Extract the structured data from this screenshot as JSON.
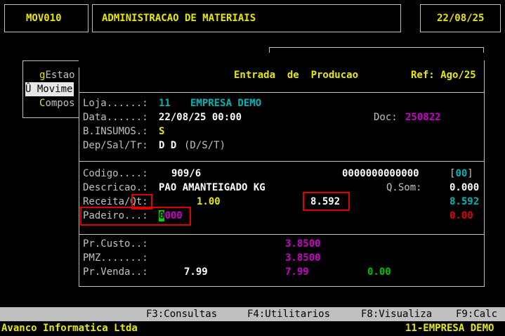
{
  "header": {
    "program": "MOV010",
    "title": "ADMINISTRACAO DE MATERIAIS",
    "date": "22/08/25"
  },
  "menu": {
    "items": [
      {
        "hot": "g",
        "rest": "Estao"
      },
      {
        "hot": "Û",
        "rest": " Movime"
      },
      {
        "hot": "C",
        "rest": "ompos"
      }
    ]
  },
  "form": {
    "title": "Entrada  de  Producao",
    "ref": "Ref: Ago/25",
    "loja_label": "Loja......:",
    "loja_code": "11",
    "loja_name": "EMPRESA DEMO",
    "data_label": "Data......:",
    "data_value": "22/08/25 00:00",
    "doc_label": "Doc:",
    "doc_value": "250822",
    "insumos_label": "B.INSUMOS.:",
    "insumos_value": "S",
    "dep_label": "Dep/Sal/Tr:",
    "dep_value": "D D",
    "dep_hint": "(D/S/T)",
    "codigo_label": "Codigo....:",
    "codigo_value": "909/6",
    "barcode": "0000000000000",
    "bracket_value": "00",
    "descricao_label": "Descricao.:",
    "descricao_value": "PAO AMANTEIGADO KG",
    "qsom_label": "Q.Som:",
    "qsom_value": "0.000",
    "receita_label": "Receita/Qt:",
    "receita_value": "1.00",
    "receita_qty": "8.592",
    "receita_right": "8.592",
    "padeiro_label": "Padeiro...:",
    "padeiro_cursor": "0",
    "padeiro_value": "000",
    "padeiro_right": "0.00",
    "custo_label": "Pr.Custo..:",
    "custo_value": "3.8500",
    "pmz_label": "PMZ.......:",
    "pmz_value": "3.8500",
    "venda_label": "Pr.Venda..:",
    "venda_value1": "7.99",
    "venda_value2": "7.99",
    "venda_value3": "0.00"
  },
  "fkeys": {
    "f3": "F3:Consultas",
    "f4": "F4:Utilitarios",
    "f8": "F8:Visualiza",
    "f9": "F9:Calc"
  },
  "status": {
    "company": "Avanco Informatica Ltda",
    "store": "11-EMPRESA DEMO"
  },
  "colors": {
    "yellow": "#e8e800",
    "cyan": "#00b4b4",
    "magenta": "#c800c8",
    "red": "#e00000",
    "green": "#00c000"
  }
}
